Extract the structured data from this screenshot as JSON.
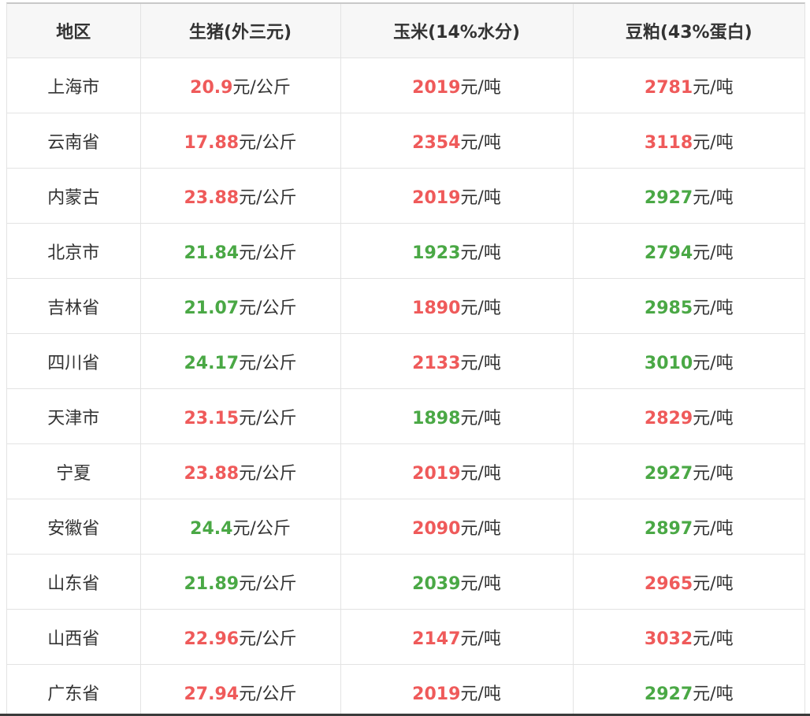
{
  "colors": {
    "up": "#ef5a5a",
    "down": "#4aa845",
    "text": "#333333",
    "header_bg": "#f7f7f7",
    "border": "#e3e3e3"
  },
  "table": {
    "headers": [
      "地区",
      "生猪(外三元)",
      "玉米(14%水分)",
      "豆粕(43%蛋白)"
    ],
    "rows": [
      {
        "region": "上海市",
        "pig": {
          "value": "20.9",
          "unit": "元/公斤",
          "trend": "up"
        },
        "corn": {
          "value": "2019",
          "unit": "元/吨",
          "trend": "up"
        },
        "meal": {
          "value": "2781",
          "unit": "元/吨",
          "trend": "up"
        }
      },
      {
        "region": "云南省",
        "pig": {
          "value": "17.88",
          "unit": "元/公斤",
          "trend": "up"
        },
        "corn": {
          "value": "2354",
          "unit": "元/吨",
          "trend": "up"
        },
        "meal": {
          "value": "3118",
          "unit": "元/吨",
          "trend": "up"
        }
      },
      {
        "region": "内蒙古",
        "pig": {
          "value": "23.88",
          "unit": "元/公斤",
          "trend": "up"
        },
        "corn": {
          "value": "2019",
          "unit": "元/吨",
          "trend": "up"
        },
        "meal": {
          "value": "2927",
          "unit": "元/吨",
          "trend": "down"
        }
      },
      {
        "region": "北京市",
        "pig": {
          "value": "21.84",
          "unit": "元/公斤",
          "trend": "down"
        },
        "corn": {
          "value": "1923",
          "unit": "元/吨",
          "trend": "down"
        },
        "meal": {
          "value": "2794",
          "unit": "元/吨",
          "trend": "down"
        }
      },
      {
        "region": "吉林省",
        "pig": {
          "value": "21.07",
          "unit": "元/公斤",
          "trend": "down"
        },
        "corn": {
          "value": "1890",
          "unit": "元/吨",
          "trend": "up"
        },
        "meal": {
          "value": "2985",
          "unit": "元/吨",
          "trend": "down"
        }
      },
      {
        "region": "四川省",
        "pig": {
          "value": "24.17",
          "unit": "元/公斤",
          "trend": "down"
        },
        "corn": {
          "value": "2133",
          "unit": "元/吨",
          "trend": "up"
        },
        "meal": {
          "value": "3010",
          "unit": "元/吨",
          "trend": "down"
        }
      },
      {
        "region": "天津市",
        "pig": {
          "value": "23.15",
          "unit": "元/公斤",
          "trend": "up"
        },
        "corn": {
          "value": "1898",
          "unit": "元/吨",
          "trend": "down"
        },
        "meal": {
          "value": "2829",
          "unit": "元/吨",
          "trend": "up"
        }
      },
      {
        "region": "宁夏",
        "pig": {
          "value": "23.88",
          "unit": "元/公斤",
          "trend": "up"
        },
        "corn": {
          "value": "2019",
          "unit": "元/吨",
          "trend": "up"
        },
        "meal": {
          "value": "2927",
          "unit": "元/吨",
          "trend": "down"
        }
      },
      {
        "region": "安徽省",
        "pig": {
          "value": "24.4",
          "unit": "元/公斤",
          "trend": "down"
        },
        "corn": {
          "value": "2090",
          "unit": "元/吨",
          "trend": "up"
        },
        "meal": {
          "value": "2897",
          "unit": "元/吨",
          "trend": "down"
        }
      },
      {
        "region": "山东省",
        "pig": {
          "value": "21.89",
          "unit": "元/公斤",
          "trend": "down"
        },
        "corn": {
          "value": "2039",
          "unit": "元/吨",
          "trend": "down"
        },
        "meal": {
          "value": "2965",
          "unit": "元/吨",
          "trend": "up"
        }
      },
      {
        "region": "山西省",
        "pig": {
          "value": "22.96",
          "unit": "元/公斤",
          "trend": "up"
        },
        "corn": {
          "value": "2147",
          "unit": "元/吨",
          "trend": "up"
        },
        "meal": {
          "value": "3032",
          "unit": "元/吨",
          "trend": "up"
        }
      },
      {
        "region": "广东省",
        "pig": {
          "value": "27.94",
          "unit": "元/公斤",
          "trend": "up"
        },
        "corn": {
          "value": "2019",
          "unit": "元/吨",
          "trend": "up"
        },
        "meal": {
          "value": "2927",
          "unit": "元/吨",
          "trend": "down"
        }
      }
    ]
  }
}
